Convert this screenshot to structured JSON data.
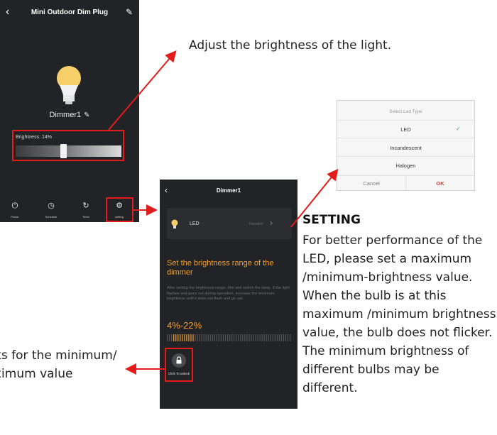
{
  "phone1": {
    "title": "Mini Outdoor Dim Plug",
    "device_name": "Dimmer1",
    "brightness_label": "Brightness: 14%",
    "brightness_level": 0.14,
    "tabs": [
      {
        "label": "Power",
        "icon": "power-icon"
      },
      {
        "label": "Schedule",
        "icon": "clock-icon"
      },
      {
        "label": "Timer",
        "icon": "timer-icon"
      },
      {
        "label": "setting",
        "icon": "gear-icon"
      }
    ]
  },
  "phone2": {
    "title": "Dimmer1",
    "led_label": "LED",
    "reselect_label": "Reselect",
    "range_title": "Set the brightness range of the dimmer",
    "range_desc": "After setting the brightness range, dim and switch the lamp. If the light flashes and goes out during operation, increase the minimum brightness until it does not flash and go out.",
    "range_value": "4%-22%",
    "lock_label": "Click To unlock"
  },
  "dialog": {
    "title": "Select Led Type",
    "options": [
      "LED",
      "Incandescent",
      "Halogen"
    ],
    "selected": "LED",
    "cancel": "Cancel",
    "ok": "OK"
  },
  "annotations": {
    "top": "Adjust the brightness of the light.",
    "setting_heading": "SETTING",
    "setting_body": "For better performance of the LED, please set a maximum /minimum-brightness value. When the bulb is at this maximum /minimum brightness value, the bulb does not flicker. The minimum brightness of different bulbs may be different.",
    "left_line1": "ks for the minimum/",
    "left_line2": "ximum value"
  },
  "colors": {
    "accent": "#f0a030",
    "highlight": "#e31b1b",
    "phone_bg": "#222326",
    "check": "#2ea36a",
    "ok": "#e23a2a"
  }
}
